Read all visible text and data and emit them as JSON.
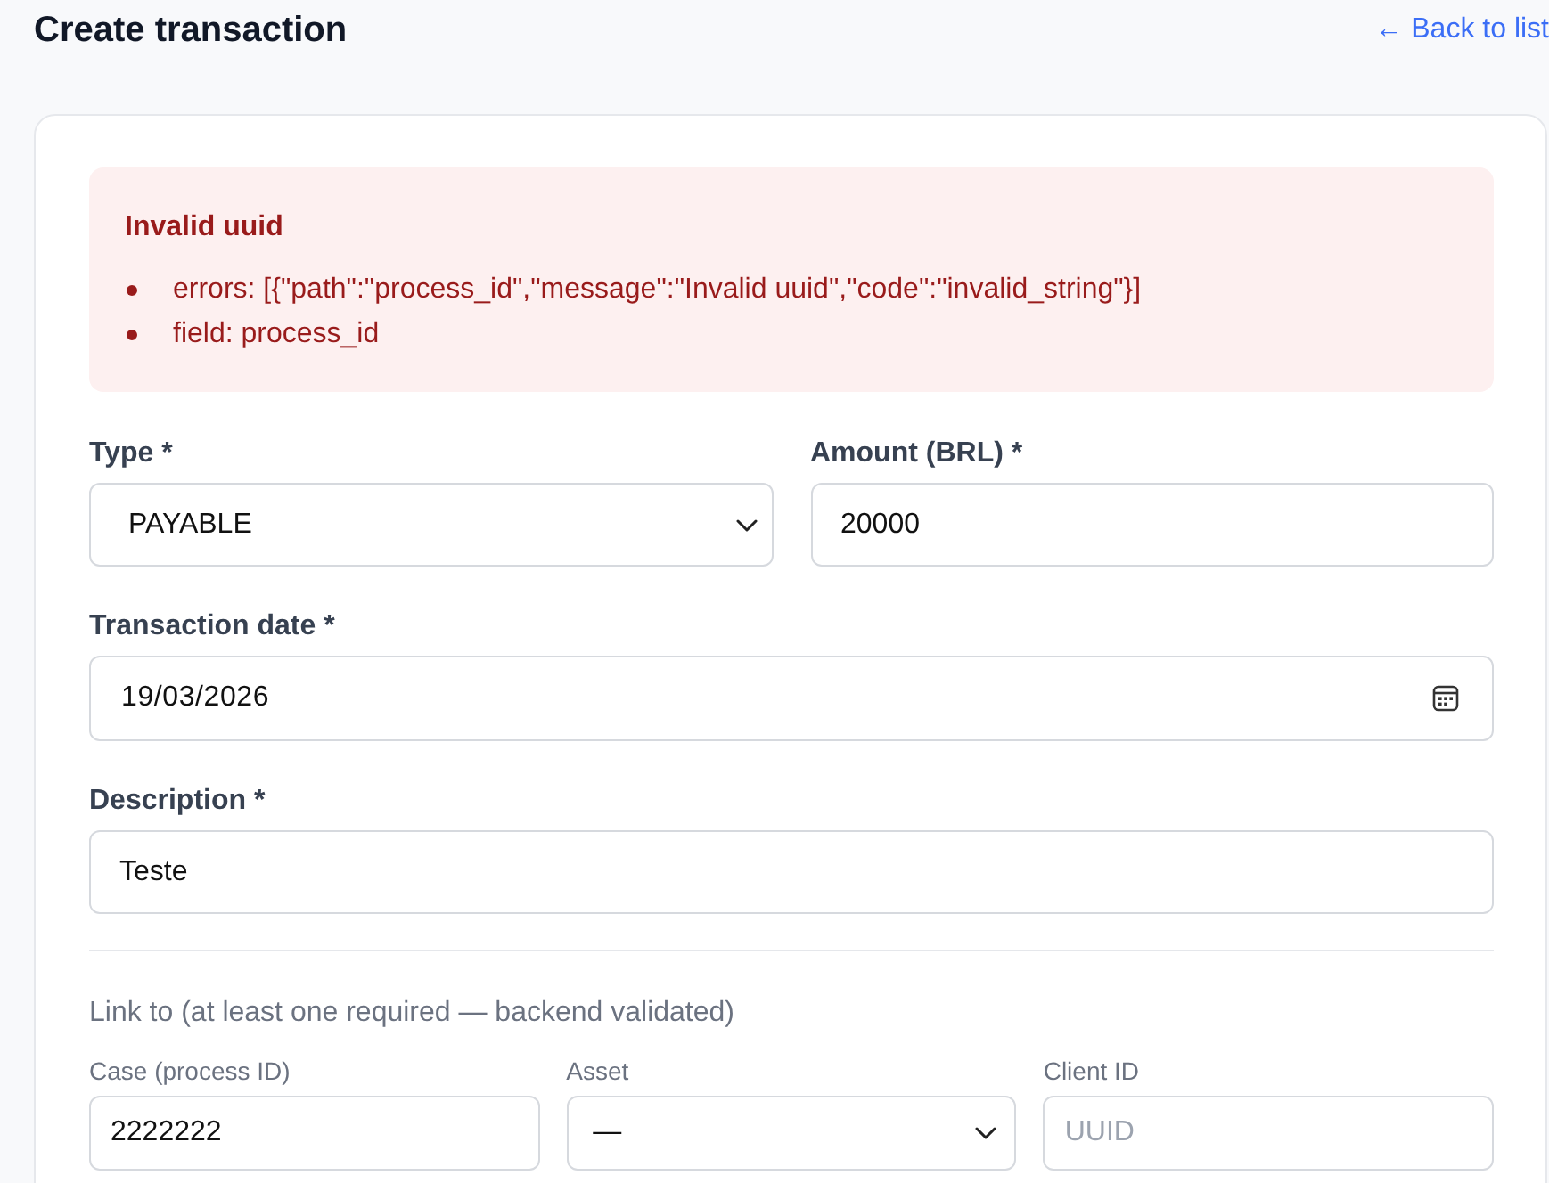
{
  "header": {
    "title": "Create transaction",
    "back_link": "← Back to list"
  },
  "error_alert": {
    "title": "Invalid uuid",
    "items": [
      "errors: [{\"path\":\"process_id\",\"message\":\"Invalid uuid\",\"code\":\"invalid_string\"}]",
      "field: process_id"
    ]
  },
  "form_rows": [
    {
      "fields": [
        {
          "kind": "select",
          "label": "Type *",
          "value": "PAYABLE"
        },
        {
          "kind": "text",
          "label": "Amount (BRL) *",
          "value": "20000"
        }
      ]
    },
    {
      "fields": [
        {
          "kind": "date",
          "label": "Transaction date *",
          "value": "19/03/2026"
        }
      ]
    },
    {
      "fields": [
        {
          "kind": "text",
          "label": "Description *",
          "value": "Teste"
        }
      ]
    }
  ],
  "link_section": {
    "heading": "Link to (at least one required — backend validated)",
    "fields": [
      {
        "kind": "text",
        "label": "Case (process ID)",
        "value": "2222222"
      },
      {
        "kind": "select",
        "label": "Asset",
        "value": "—"
      },
      {
        "kind": "text",
        "label": "Client ID",
        "placeholder": "UUID"
      }
    ]
  }
}
